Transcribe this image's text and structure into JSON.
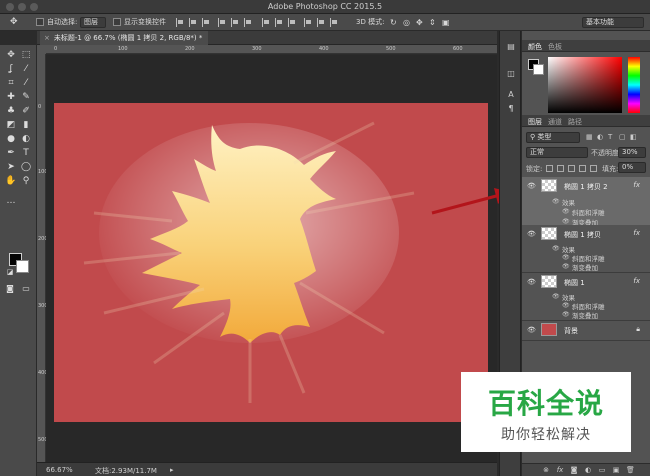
{
  "window": {
    "title": "Adobe Photoshop CC 2015.5"
  },
  "options_bar": {
    "auto_select_label": "自动选择:",
    "auto_select_value": "图层",
    "show_transform_label": "显示变换控件",
    "mode_3d_label": "3D 模式:",
    "workspace_value": "基本功能"
  },
  "document_tab": {
    "close_glyph": "×",
    "title": "未标题-1 @ 66.7% (椭圆 1 拷贝 2, RGB/8*) *"
  },
  "rulers": {
    "top": [
      "0",
      "100",
      "200",
      "300",
      "400",
      "500",
      "600"
    ],
    "left": [
      "0",
      "100",
      "200",
      "300",
      "400",
      "500"
    ]
  },
  "status_bar": {
    "zoom": "66.67%",
    "doc_info": "文档:2.93M/11.7M"
  },
  "color_panel": {
    "tabs": [
      "颜色",
      "色板"
    ],
    "fg_color": "#000000",
    "bg_color": "#ffffff"
  },
  "layers_panel": {
    "tabs": [
      "图层",
      "通道",
      "路径"
    ],
    "filter_kind": "类型",
    "blend_mode": "正常",
    "opacity_label": "不透明度:",
    "opacity_value": "30%",
    "lock_label": "锁定:",
    "fill_label": "填充:",
    "fill_value": "0%",
    "layers": [
      {
        "name": "椭圆 1 拷贝 2",
        "fx": "fx",
        "effects_label": "效果",
        "effects": [
          "斜面和浮雕",
          "渐变叠加"
        ],
        "selected": true
      },
      {
        "name": "椭圆 1 拷贝",
        "fx": "fx",
        "effects_label": "效果",
        "effects": [
          "斜面和浮雕",
          "渐变叠加"
        ],
        "selected": false
      },
      {
        "name": "椭圆 1",
        "fx": "fx",
        "effects_label": "效果",
        "effects": [
          "斜面和浮雕",
          "渐变叠加"
        ],
        "selected": false
      }
    ],
    "background_layer": {
      "name": "背景",
      "color": "#c14a4c"
    },
    "footer_icons": [
      "link-icon",
      "fx-icon",
      "mask-icon",
      "adjustment-icon",
      "folder-icon",
      "new-layer-icon",
      "trash-icon"
    ]
  },
  "watermark": {
    "title": "百科全说",
    "subtitle": "助你轻松解决"
  },
  "colors": {
    "canvas": "#c14a4c",
    "annotation_arrow": "#b3151b"
  }
}
